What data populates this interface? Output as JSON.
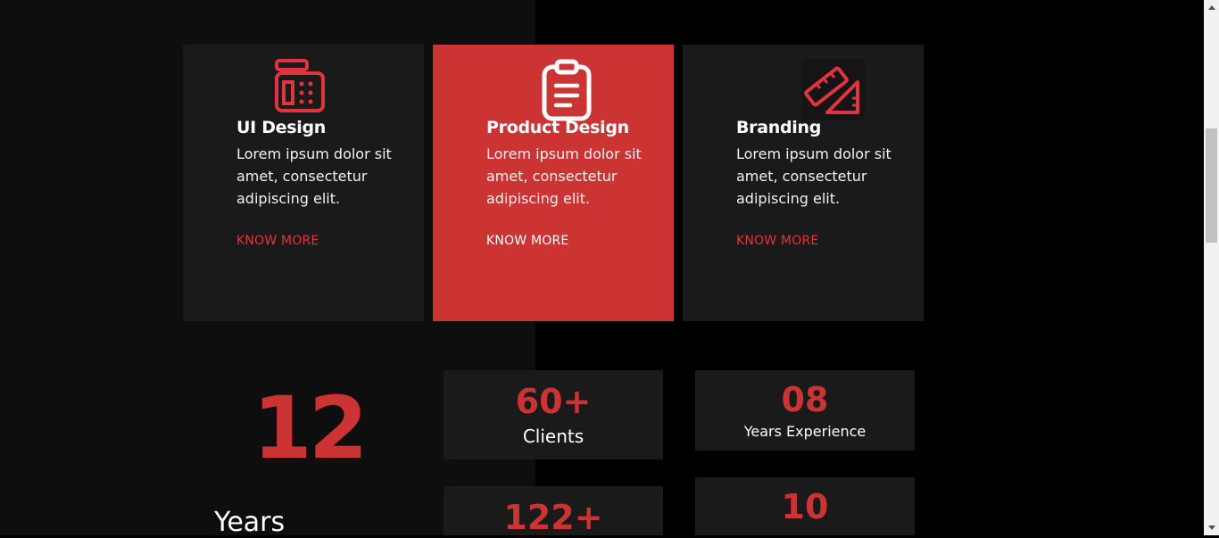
{
  "services": [
    {
      "title": "UI Design",
      "text": "Lorem ipsum dolor sit amet, consectetur adipiscing elit.",
      "link": "KNOW MORE",
      "icon": "calculator-icon"
    },
    {
      "title": "Product Design",
      "text": "Lorem ipsum dolor sit amet, consectetur adipiscing elit.",
      "link": "KNOW MORE",
      "icon": "clipboard-icon"
    },
    {
      "title": "Branding",
      "text": "Lorem ipsum dolor sit amet, consectetur adipiscing elit.",
      "link": "KNOW MORE",
      "icon": "ruler-icon"
    }
  ],
  "stats": {
    "big_value": "12",
    "big_label": "Years",
    "clients_value": "60+",
    "clients_label": "Clients",
    "experience_value": "08",
    "experience_label": "Years Experience",
    "projects_value": "122+",
    "fourth_value": "10"
  },
  "colors": {
    "accent": "#cc3333",
    "card_bg": "#1a1a1a",
    "page_bg": "#000000"
  }
}
